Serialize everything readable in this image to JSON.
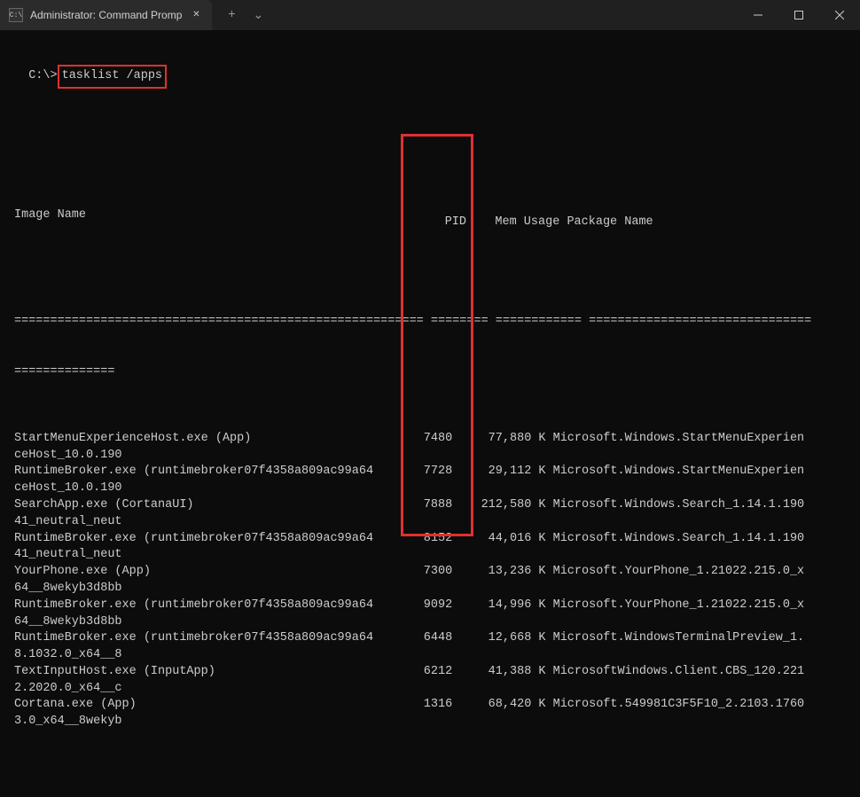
{
  "titlebar": {
    "tab_title": "Administrator: Command Promp",
    "tab_icon_glyph": "C:\\"
  },
  "prompt": {
    "prefix": "C:\\>",
    "command": "tasklist /apps"
  },
  "headers": {
    "image_name": "Image Name",
    "pid": "PID",
    "mem_usage": "Mem Usage",
    "package_name": "Package Name"
  },
  "separator_line1": "========================================================= ======== ============ ===============================",
  "separator_line2": "==============",
  "chart_data": {
    "type": "table",
    "columns": [
      "Image Name",
      "PID",
      "Mem Usage",
      "Package Name"
    ],
    "rows": [
      {
        "image": "StartMenuExperienceHost.exe (App)",
        "pid": 7480,
        "mem": "77,880 K",
        "pkg": "Microsoft.Windows.StartMenuExperien",
        "wrap": "ceHost_10.0.190"
      },
      {
        "image": "RuntimeBroker.exe (runtimebroker07f4358a809ac99a64",
        "pid": 7728,
        "mem": "29,112 K",
        "pkg": "Microsoft.Windows.StartMenuExperien",
        "wrap": "ceHost_10.0.190"
      },
      {
        "image": "SearchApp.exe (CortanaUI)",
        "pid": 7888,
        "mem": "212,580 K",
        "pkg": "Microsoft.Windows.Search_1.14.1.190",
        "wrap": "41_neutral_neut"
      },
      {
        "image": "RuntimeBroker.exe (runtimebroker07f4358a809ac99a64",
        "pid": 8152,
        "mem": "44,016 K",
        "pkg": "Microsoft.Windows.Search_1.14.1.190",
        "wrap": "41_neutral_neut"
      },
      {
        "image": "YourPhone.exe (App)",
        "pid": 7300,
        "mem": "13,236 K",
        "pkg": "Microsoft.YourPhone_1.21022.215.0_x",
        "wrap": "64__8wekyb3d8bb"
      },
      {
        "image": "RuntimeBroker.exe (runtimebroker07f4358a809ac99a64",
        "pid": 9092,
        "mem": "14,996 K",
        "pkg": "Microsoft.YourPhone_1.21022.215.0_x",
        "wrap": "64__8wekyb3d8bb"
      },
      {
        "image": "RuntimeBroker.exe (runtimebroker07f4358a809ac99a64",
        "pid": 6448,
        "mem": "12,668 K",
        "pkg": "Microsoft.WindowsTerminalPreview_1.",
        "wrap": "8.1032.0_x64__8"
      },
      {
        "image": "TextInputHost.exe (InputApp)",
        "pid": 6212,
        "mem": "41,388 K",
        "pkg": "MicrosoftWindows.Client.CBS_120.221",
        "wrap": "2.2020.0_x64__c"
      },
      {
        "image": "Cortana.exe (App)",
        "pid": 1316,
        "mem": "68,420 K",
        "pkg": "Microsoft.549981C3F5F10_2.2103.1760",
        "wrap": "3.0_x64__8wekyb"
      }
    ]
  }
}
